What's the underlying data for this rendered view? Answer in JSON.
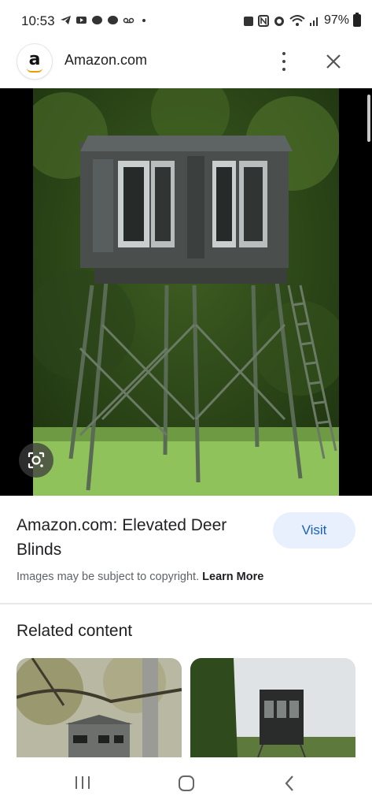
{
  "status_bar": {
    "time": "10:53",
    "battery": "97%"
  },
  "header": {
    "logo_letter": "a",
    "site_name": "Amazon.com"
  },
  "image": {
    "alt": "Elevated deer blind on steel stand"
  },
  "result": {
    "title": "Amazon.com: Elevated Deer Blinds",
    "visit_label": "Visit",
    "copyright_text": "Images may be subject to copyright.",
    "learn_more": "Learn More"
  },
  "related": {
    "heading": "Related content"
  },
  "colors": {
    "accent": "#1a5fb4",
    "visit_bg": "#e8f0fe",
    "amazon_orange": "#f29b00"
  }
}
